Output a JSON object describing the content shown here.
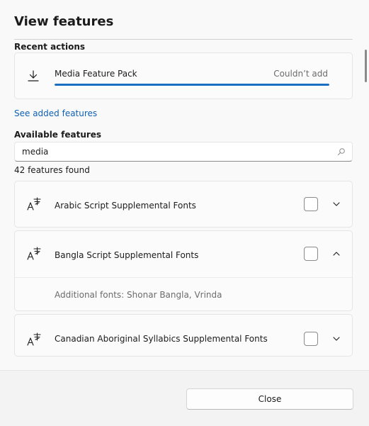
{
  "dialog": {
    "title": "View features"
  },
  "recent": {
    "label": "Recent actions",
    "item": {
      "name": "Media Feature Pack",
      "status": "Couldn’t add",
      "progress": 1.0,
      "icon": "download-icon"
    }
  },
  "see_added_link": "See added features",
  "available": {
    "label": "Available features",
    "search_value": "media",
    "search_icon": "search-icon",
    "count_text": "42 features found",
    "features": [
      {
        "name": "Arabic Script Supplemental Fonts",
        "checked": false,
        "expanded": false
      },
      {
        "name": "Bangla Script Supplemental Fonts",
        "checked": false,
        "expanded": true,
        "detail": "Additional fonts: Shonar Bangla, Vrinda"
      },
      {
        "name": "Canadian Aboriginal Syllabics Supplemental Fonts",
        "checked": false,
        "expanded": false
      }
    ]
  },
  "footer": {
    "close_label": "Close"
  },
  "colors": {
    "accent": "#1b6ec2",
    "link": "#1060b0"
  }
}
